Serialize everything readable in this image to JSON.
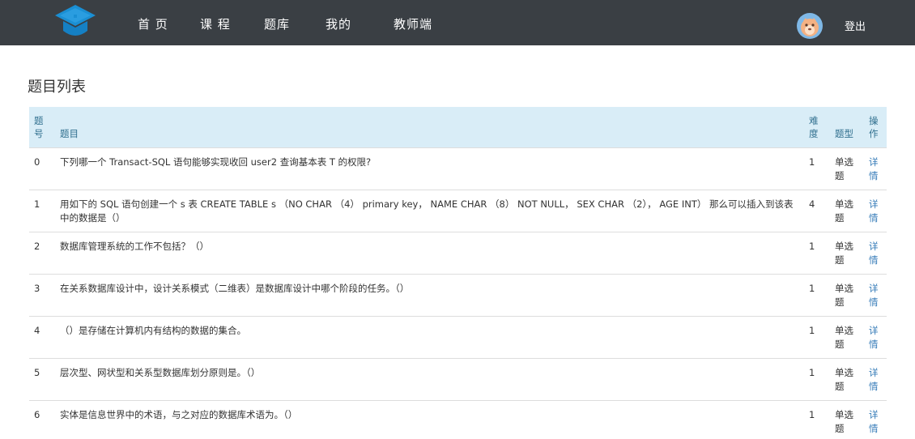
{
  "nav": {
    "home": "首 页",
    "courses": "课 程",
    "questions": "题库",
    "mine": "我的",
    "teacher": "教师端",
    "logout": "登出"
  },
  "page": {
    "title": "题目列表"
  },
  "table": {
    "headers": {
      "id": "题号",
      "question": "题目",
      "difficulty": "难度",
      "type": "题型",
      "action": "操作"
    },
    "rows": [
      {
        "id": "0",
        "question": "下列哪一个 Transact-SQL 语句能够实现收回 user2 查询基本表 T 的权限?",
        "difficulty": "1",
        "type": "单选题",
        "action": "详情"
      },
      {
        "id": "1",
        "question": "用如下的 SQL 语句创建一个 s 表 CREATE TABLE s （NO CHAR （4） primary key， NAME CHAR （8） NOT NULL， SEX CHAR （2）， AGE INT） 那么可以插入到该表中的数据是（）",
        "difficulty": "4",
        "type": "单选题",
        "action": "详情"
      },
      {
        "id": "2",
        "question": "数据库管理系统的工作不包括？（）",
        "difficulty": "1",
        "type": "单选题",
        "action": "详情"
      },
      {
        "id": "3",
        "question": "在关系数据库设计中，设计关系模式（二维表）是数据库设计中哪个阶段的任务。（）",
        "difficulty": "1",
        "type": "单选题",
        "action": "详情"
      },
      {
        "id": "4",
        "question": " （）是存储在计算机内有结构的数据的集合。",
        "difficulty": "1",
        "type": "单选题",
        "action": "详情"
      },
      {
        "id": "5",
        "question": "层次型、网状型和关系型数据库划分原则是。（）",
        "difficulty": "1",
        "type": "单选题",
        "action": "详情"
      },
      {
        "id": "6",
        "question": "实体是信息世界中的术语，与之对应的数据库术语为。（）",
        "difficulty": "1",
        "type": "单选题",
        "action": "详情"
      }
    ]
  }
}
